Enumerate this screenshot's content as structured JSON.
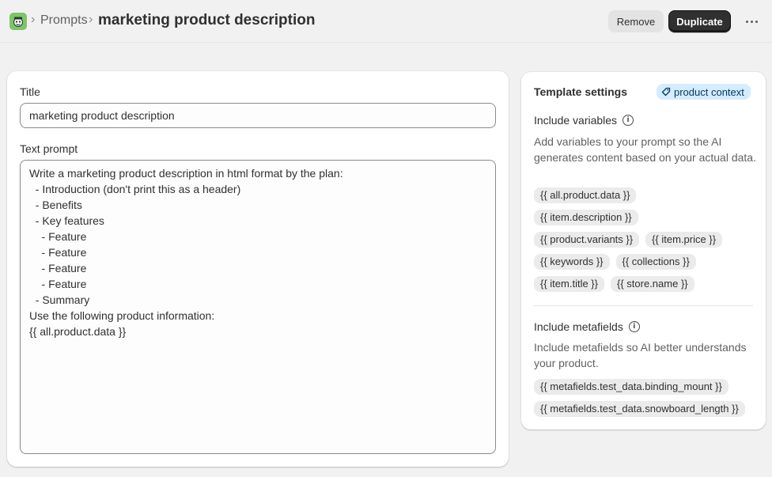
{
  "header": {
    "breadcrumb_link": "Prompts",
    "page_title": "marketing product description",
    "remove_label": "Remove",
    "duplicate_label": "Duplicate"
  },
  "form": {
    "title_label": "Title",
    "title_value": "marketing product description",
    "prompt_label": "Text prompt",
    "prompt_value": "Write a marketing product description in html format by the plan:\n  - Introduction (don't print this as a header)\n  - Benefits\n  - Key features\n    - Feature\n    - Feature\n    - Feature\n    - Feature\n  - Summary\nUse the following product information:\n{{ all.product.data }}"
  },
  "settings": {
    "heading": "Template settings",
    "context_badge": "product context",
    "variables": {
      "title": "Include variables",
      "description": "Add variables to your prompt so the AI generates content based on your actual data.",
      "chips": [
        "{{ all.product.data }}",
        "{{ item.description }}",
        "{{ product.variants }}",
        "{{ item.price }}",
        "{{ keywords }}",
        "{{ collections }}",
        "{{ item.title }}",
        "{{ store.name }}"
      ]
    },
    "metafields": {
      "title": "Include metafields",
      "description": "Include metafields so AI better understands your product.",
      "chips": [
        "{{ metafields.test_data.binding_mount }}",
        "{{ metafields.test_data.snowboard_length }}"
      ]
    }
  },
  "colors": {
    "page_bg": "#f1f1f1",
    "primary_button": "#303030",
    "badge_bg": "#d5ebff",
    "chip_bg": "#ebebeb"
  }
}
